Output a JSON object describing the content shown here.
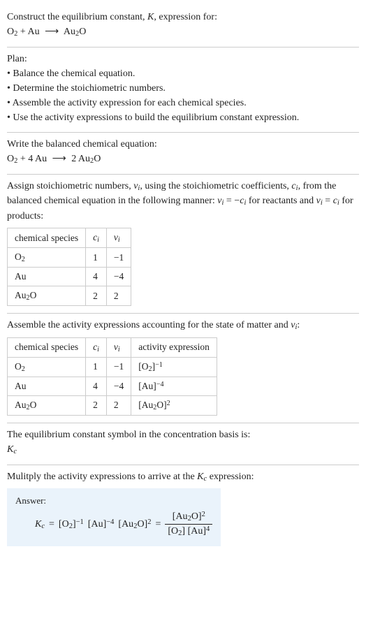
{
  "intro": {
    "l1": "Construct the equilibrium constant, ",
    "K": "K",
    "l1b": ", expression for:",
    "eq_O2": "O",
    "eq_sub2": "2",
    "eq_plus": " + Au ",
    "eq_arrow": "⟶",
    "eq_Au2O_a": " Au",
    "eq_Au2O_b": "O"
  },
  "plan": {
    "title": "Plan:",
    "b1": "• Balance the chemical equation.",
    "b2": "• Determine the stoichiometric numbers.",
    "b3": "• Assemble the activity expression for each chemical species.",
    "b4": "• Use the activity expressions to build the equilibrium constant expression."
  },
  "balanced": {
    "title": "Write the balanced chemical equation:",
    "lhs_a": "O",
    "lhs_b": " + 4 Au ",
    "arrow": "⟶",
    "rhs_a": " 2 Au",
    "rhs_b": "O"
  },
  "stoich": {
    "text_a": "Assign stoichiometric numbers, ",
    "nu": "ν",
    "nu_i": "i",
    "text_b": ", using the stoichiometric coefficients, ",
    "c": "c",
    "c_i": "i",
    "text_c": ", from the balanced chemical equation in the following manner: ",
    "rel_a": " = −",
    "text_d": " for reactants and ",
    "rel_b": " = ",
    "text_e": " for products:",
    "headers": {
      "h1": "chemical species",
      "h2": "cᵢ",
      "h3": "νᵢ"
    },
    "rows": [
      {
        "sp_a": "O",
        "sp_b": "",
        "c": "1",
        "nu": "−1"
      },
      {
        "sp_a": "Au",
        "sp_b": "",
        "c": "4",
        "nu": "−4"
      },
      {
        "sp_a": "Au",
        "sp_b": "O",
        "c": "2",
        "nu": "2"
      }
    ]
  },
  "activity": {
    "text_a": "Assemble the activity expressions accounting for the state of matter and ",
    "text_b": ":",
    "headers": {
      "h1": "chemical species",
      "h2": "cᵢ",
      "h3": "νᵢ",
      "h4": "activity expression"
    },
    "rows": [
      {
        "sp_a": "O",
        "sp_b": "",
        "c": "1",
        "nu": "−1",
        "act_a": "[O",
        "act_b": "]",
        "act_exp": "−1"
      },
      {
        "sp_a": "Au",
        "sp_b": "",
        "c": "4",
        "nu": "−4",
        "act_a": "[Au]",
        "act_b": "",
        "act_exp": "−4"
      },
      {
        "sp_a": "Au",
        "sp_b": "O",
        "c": "2",
        "nu": "2",
        "act_a": "[Au",
        "act_b": "O]",
        "act_exp": "2"
      }
    ]
  },
  "symbol": {
    "text": "The equilibrium constant symbol in the concentration basis is:",
    "K": "K",
    "Kc": "c"
  },
  "final": {
    "text_a": "Mulitply the activity expressions to arrive at the ",
    "text_b": " expression:",
    "answer_label": "Answer:",
    "lhs_K": "K",
    "lhs_c": "c",
    "eq": " = ",
    "t1_a": "[O",
    "t1_b": "]",
    "t1_e": "−1",
    "t2_a": " [Au]",
    "t2_e": "−4",
    "t3_a": " [Au",
    "t3_b": "O]",
    "t3_e": "2",
    "eq2": " = ",
    "num_a": "[Au",
    "num_b": "O]",
    "num_e": "2",
    "den_a": "[O",
    "den_b": "] [Au]",
    "den_e": "4"
  },
  "sub2": "2"
}
